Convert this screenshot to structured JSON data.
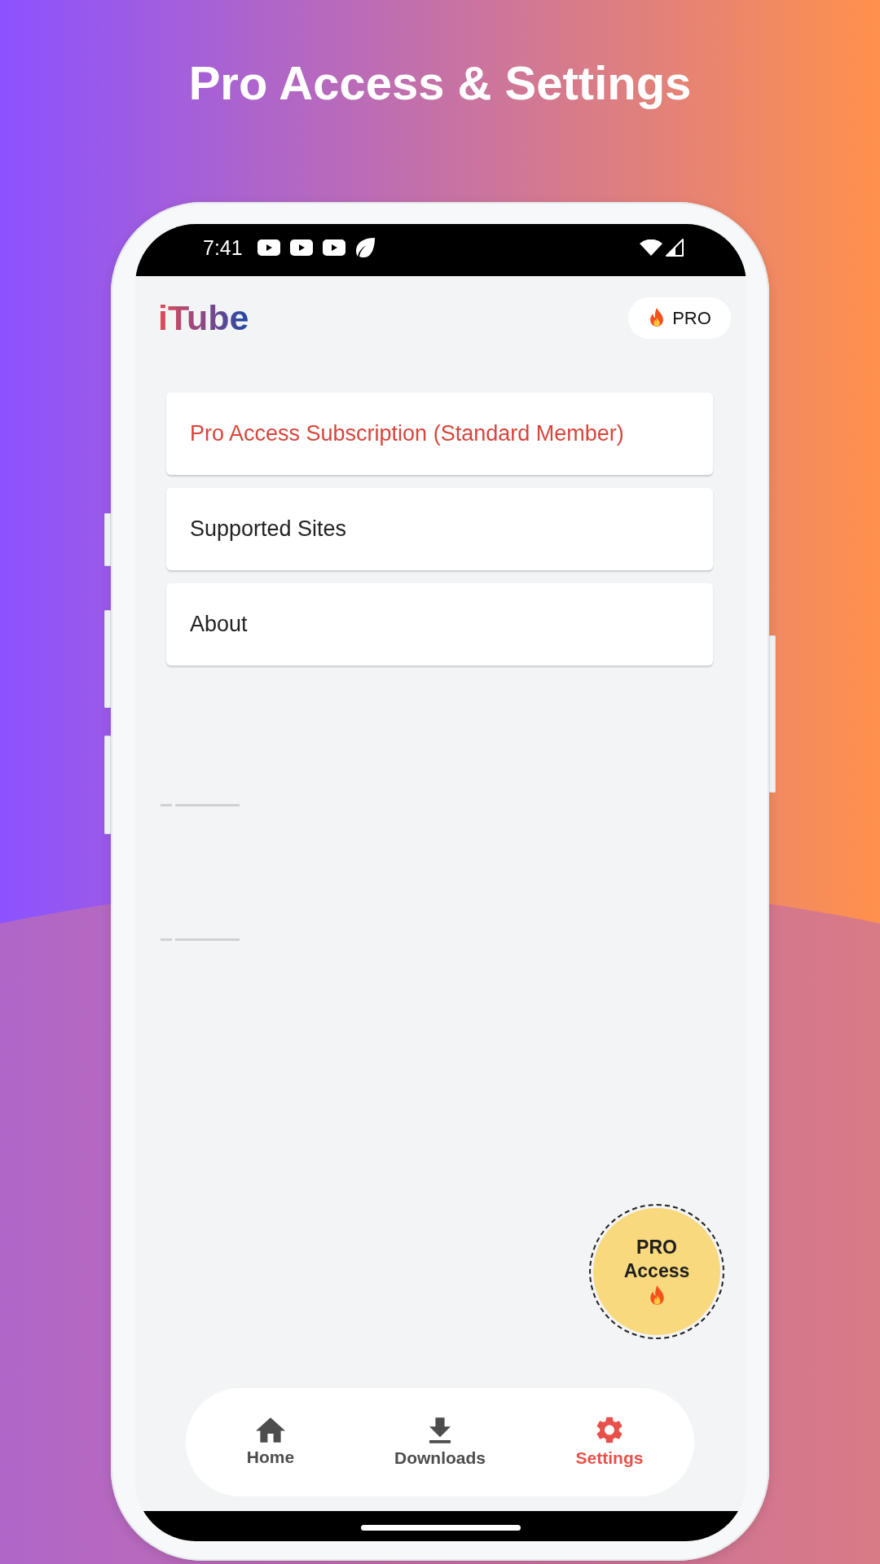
{
  "title": "Pro Access & Settings",
  "status_bar": {
    "time": "7:41"
  },
  "app_bar": {
    "logo": "iTube",
    "badge": "PRO"
  },
  "menu": [
    {
      "label": "Pro Access Subscription (Standard Member)",
      "accent": true
    },
    {
      "label": "Supported Sites",
      "accent": false
    },
    {
      "label": "About",
      "accent": false
    }
  ],
  "fab": {
    "label": "PRO Access"
  },
  "nav": [
    {
      "label": "Home",
      "selected": false
    },
    {
      "label": "Downloads",
      "selected": false
    },
    {
      "label": "Settings",
      "selected": true
    }
  ]
}
